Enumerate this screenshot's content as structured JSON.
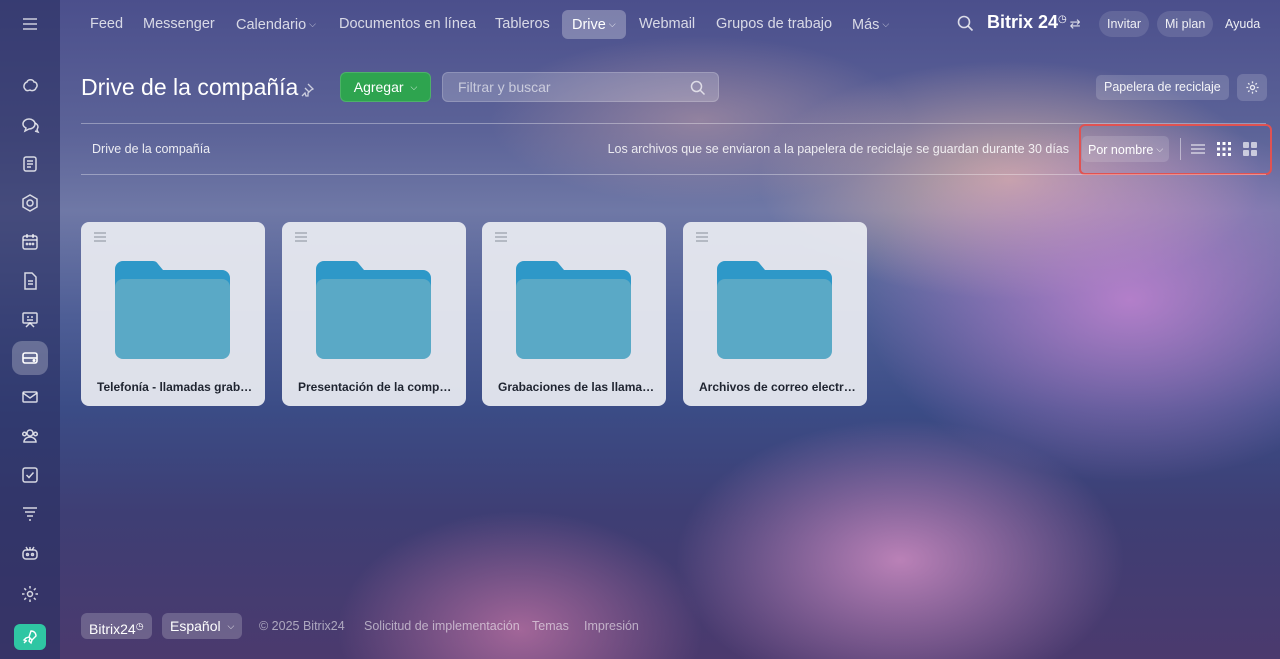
{
  "topnav": {
    "items": [
      {
        "label": "Feed"
      },
      {
        "label": "Messenger"
      },
      {
        "label": "Calendario"
      },
      {
        "label": "Documentos en línea"
      },
      {
        "label": "Tableros"
      },
      {
        "label": "Drive"
      },
      {
        "label": "Webmail"
      },
      {
        "label": "Grupos de trabajo"
      },
      {
        "label": "Más"
      }
    ],
    "brand": "Bitrix 24",
    "invite": "Invitar",
    "plan": "Mi plan",
    "help": "Ayuda"
  },
  "sidebar": {
    "icons": [
      "copilot-icon",
      "chat-icon",
      "feed-icon",
      "crm-icon",
      "calendar-icon",
      "docs-icon",
      "boards-icon",
      "drive-icon",
      "mail-icon",
      "groups-icon",
      "tasks-icon",
      "filter-icon",
      "robot-icon",
      "settings-icon",
      "rocket-icon"
    ],
    "active": "drive-icon"
  },
  "header": {
    "title": "Drive de la compañía",
    "add_label": "Agregar",
    "search_placeholder": "Filtrar y buscar",
    "trash_label": "Papelera de reciclaje"
  },
  "toolbar": {
    "breadcrumb": "Drive de la compañía",
    "info": "Los archivos que se enviaron a la papelera de reciclaje se guardan durante 30 días",
    "sort_label": "Por nombre"
  },
  "folders": [
    {
      "name": "Telefonía - llamadas grabadas"
    },
    {
      "name": "Presentación de la compañía"
    },
    {
      "name": "Grabaciones de las llamadas"
    },
    {
      "name": "Archivos de correo electrónico"
    }
  ],
  "footer": {
    "brand": "Bitrix24",
    "language": "Español",
    "copyright": "© 2025 Bitrix24",
    "implementation": "Solicitud de implementación",
    "themes": "Temas",
    "print": "Impresión"
  },
  "colors": {
    "accent_green": "#2ea44f",
    "highlight_red": "#e05252",
    "folder_tab": "#2e98c8",
    "folder_body": "#5aa9c6"
  }
}
